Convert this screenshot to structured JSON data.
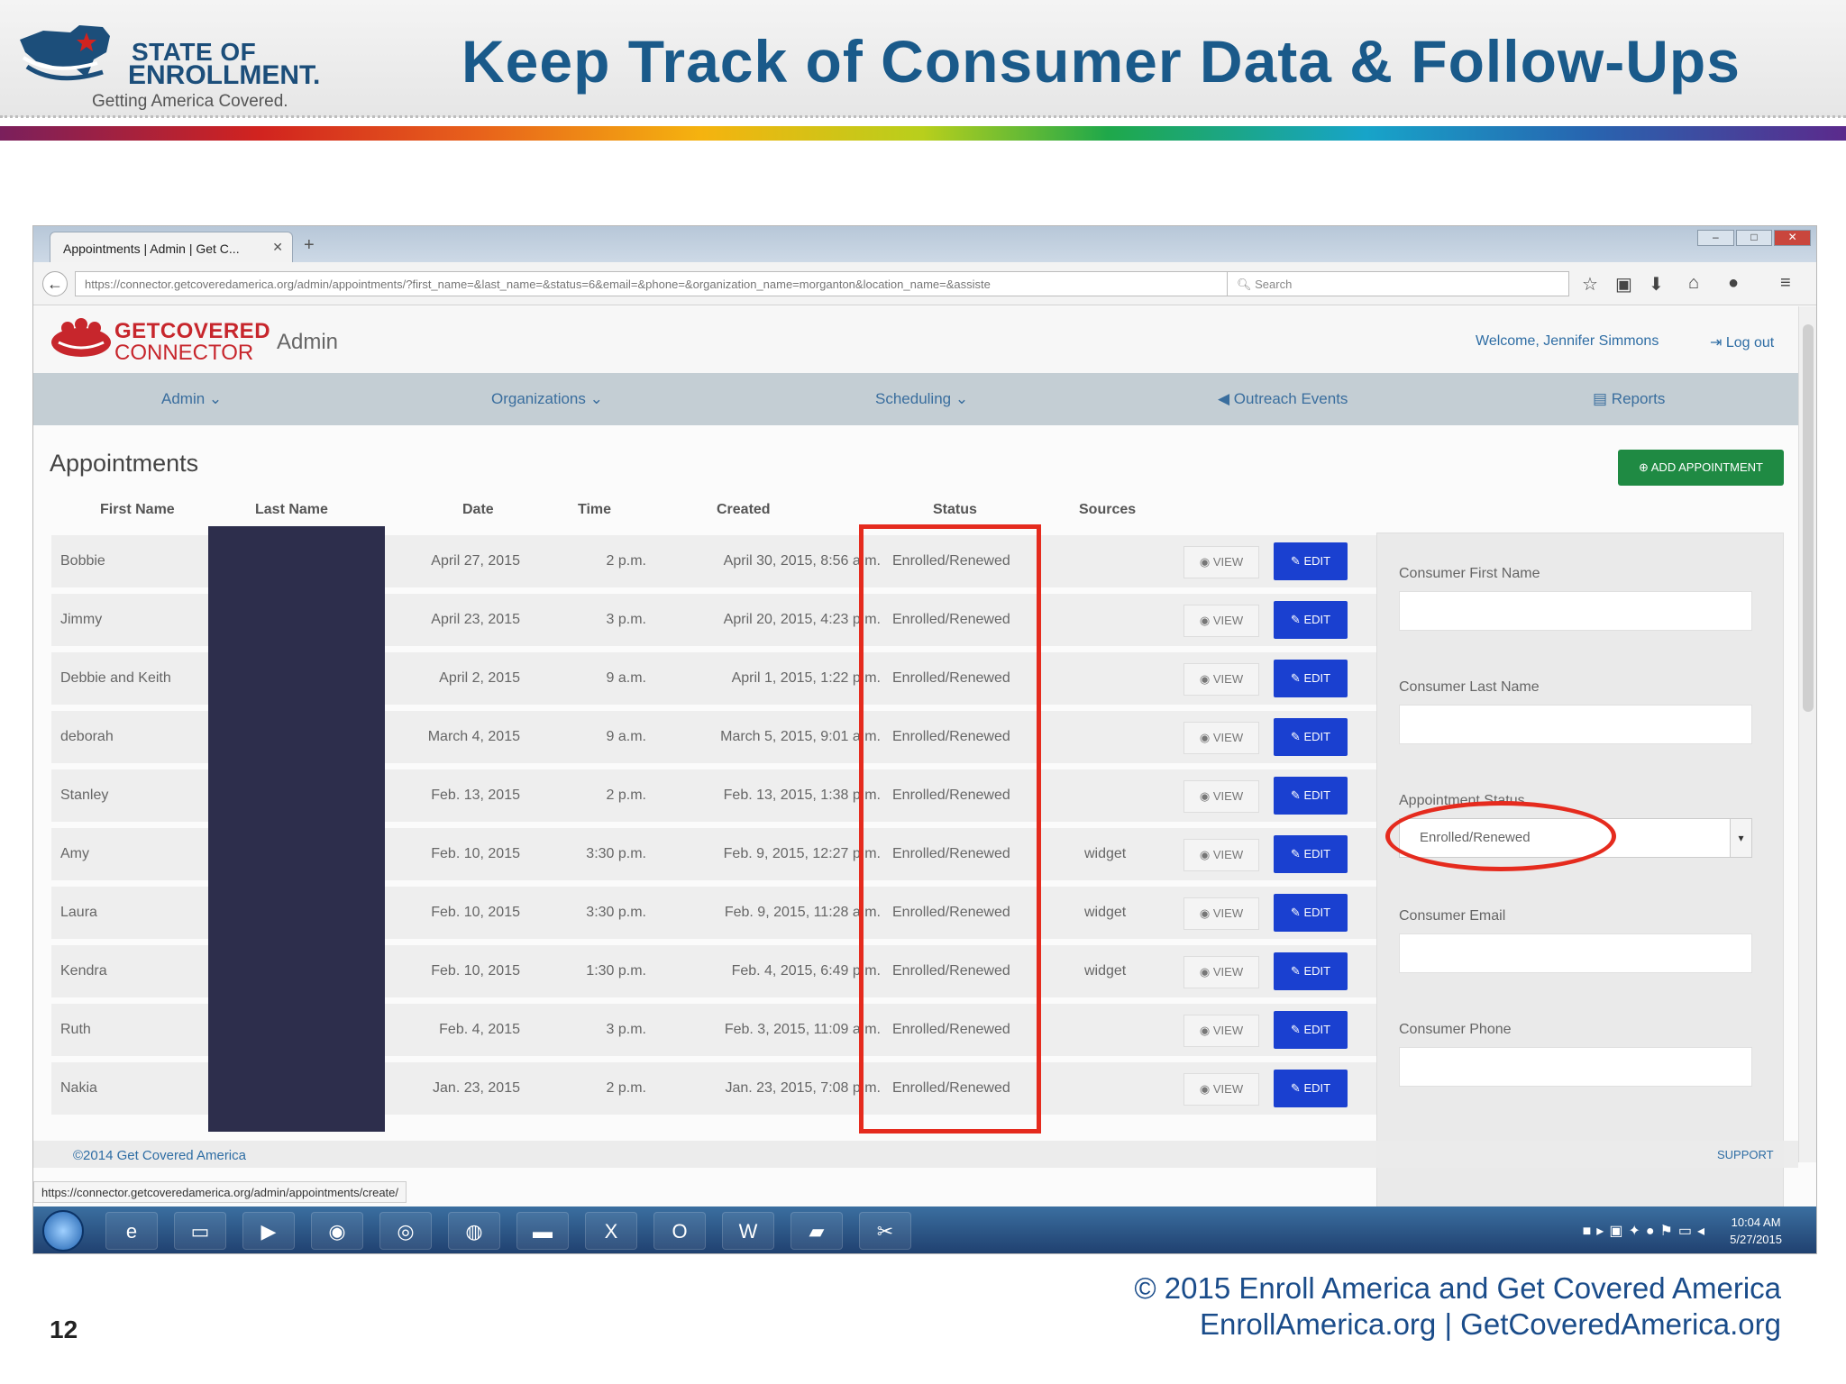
{
  "slide": {
    "logo": {
      "line1": "STATE OF",
      "line2": "ENROLLMENT.",
      "tagline": "Getting America Covered."
    },
    "title": "Keep Track of Consumer Data & Follow-Ups",
    "copyright_line1": "© 2015 Enroll America and Get Covered America",
    "copyright_line2": "EnrollAmerica.org | GetCoveredAmerica.org",
    "page_number": "12"
  },
  "browser": {
    "tab_title": "Appointments | Admin | Get C...",
    "url": "https://connector.getcoveredamerica.org/admin/appointments/?first_name=&last_name=&status=6&email=&phone=&organization_name=morganton&location_name=&assiste",
    "search_placeholder": "Search",
    "status_url": "https://connector.getcoveredamerica.org/admin/appointments/create/"
  },
  "app": {
    "brand_line1": "GETCOVERED",
    "brand_line2": "CONNECTOR",
    "brand_admin": "Admin",
    "welcome": "Welcome, Jennifer Simmons",
    "logout": "Log out",
    "menu": {
      "admin": "Admin",
      "organizations": "Organizations",
      "scheduling": "Scheduling",
      "outreach": "Outreach Events",
      "reports": "Reports"
    },
    "page_title": "Appointments",
    "add_button": "ADD APPOINTMENT",
    "columns": {
      "first_name": "First Name",
      "last_name": "Last Name",
      "date": "Date",
      "time": "Time",
      "created": "Created",
      "status": "Status",
      "sources": "Sources"
    },
    "view_label": "VIEW",
    "edit_label": "EDIT",
    "rows": [
      {
        "first": "Bobbie",
        "date": "April 27, 2015",
        "time": "2 p.m.",
        "created": "April 30, 2015, 8:56 a.m.",
        "status": "Enrolled/Renewed",
        "source": ""
      },
      {
        "first": "Jimmy",
        "date": "April 23, 2015",
        "time": "3 p.m.",
        "created": "April 20, 2015, 4:23 p.m.",
        "status": "Enrolled/Renewed",
        "source": ""
      },
      {
        "first": "Debbie and Keith",
        "date": "April 2, 2015",
        "time": "9 a.m.",
        "created": "April 1, 2015, 1:22 p.m.",
        "status": "Enrolled/Renewed",
        "source": ""
      },
      {
        "first": "deborah",
        "date": "March 4, 2015",
        "time": "9 a.m.",
        "created": "March 5, 2015, 9:01 a.m.",
        "status": "Enrolled/Renewed",
        "source": ""
      },
      {
        "first": "Stanley",
        "date": "Feb. 13, 2015",
        "time": "2 p.m.",
        "created": "Feb. 13, 2015, 1:38 p.m.",
        "status": "Enrolled/Renewed",
        "source": ""
      },
      {
        "first": "Amy",
        "date": "Feb. 10, 2015",
        "time": "3:30 p.m.",
        "created": "Feb. 9, 2015, 12:27 p.m.",
        "status": "Enrolled/Renewed",
        "source": "widget"
      },
      {
        "first": "Laura",
        "date": "Feb. 10, 2015",
        "time": "3:30 p.m.",
        "created": "Feb. 9, 2015, 11:28 a.m.",
        "status": "Enrolled/Renewed",
        "source": "widget"
      },
      {
        "first": "Kendra",
        "date": "Feb. 10, 2015",
        "time": "1:30 p.m.",
        "created": "Feb. 4, 2015, 6:49 p.m.",
        "status": "Enrolled/Renewed",
        "source": "widget"
      },
      {
        "first": "Ruth",
        "date": "Feb. 4, 2015",
        "time": "3 p.m.",
        "created": "Feb. 3, 2015, 11:09 a.m.",
        "status": "Enrolled/Renewed",
        "source": ""
      },
      {
        "first": "Nakia",
        "date": "Jan. 23, 2015",
        "time": "2 p.m.",
        "created": "Jan. 23, 2015, 7:08 p.m.",
        "status": "Enrolled/Renewed",
        "source": ""
      }
    ],
    "filter_panel": {
      "first_name_label": "Consumer First Name",
      "last_name_label": "Consumer Last Name",
      "status_label": "Appointment Status",
      "status_value": "Enrolled/Renewed",
      "email_label": "Consumer Email",
      "phone_label": "Consumer Phone"
    },
    "footer_copy": "©2014 Get Covered America",
    "footer_support": "SUPPORT"
  },
  "taskbar": {
    "time": "10:04 AM",
    "date": "5/27/2015"
  },
  "colors": {
    "title_blue": "#1a5a8a",
    "highlight_red": "#e52b1e",
    "edit_blue": "#1a40d0",
    "add_green": "#1f8a43",
    "redaction": "#2d2e4c"
  }
}
